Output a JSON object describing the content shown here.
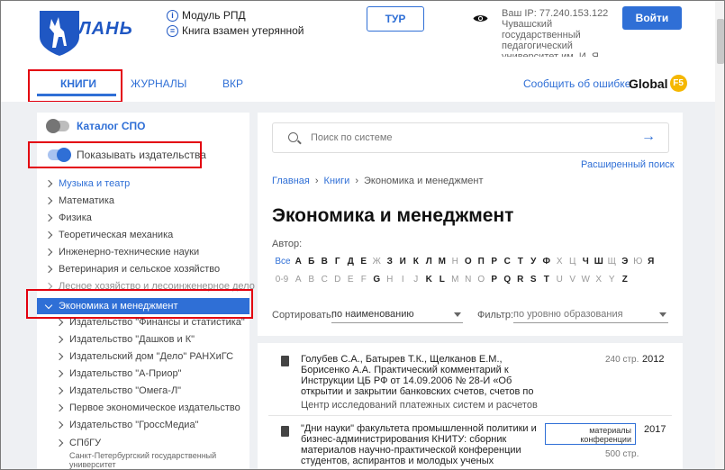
{
  "header": {
    "logo_text": "ЛАНЬ",
    "links": [
      {
        "label": "Модуль РПД",
        "icon": "info-icon"
      },
      {
        "label": "Книга взамен утерянной",
        "icon": "list-icon"
      }
    ],
    "tur_label": "ТУР",
    "ip_info": "Ваш IP: 77.240.153.122 Чувашский государственный педагогический университет им. И. Я. Я",
    "login_label": "Войти"
  },
  "tabs": [
    {
      "label": "КНИГИ",
      "active": true
    },
    {
      "label": "ЖУРНАЛЫ",
      "active": false
    },
    {
      "label": "ВКР",
      "active": false
    }
  ],
  "report_error": "Сообщить об ошибке",
  "global_brand": "Global",
  "global_badge": "F5",
  "sidebar": {
    "catalog_toggle": "Каталог СПО",
    "publishers_toggle": "Показывать издательства",
    "categories": [
      "Музыка и театр",
      "Математика",
      "Физика",
      "Теоретическая механика",
      "Инженерно-технические науки",
      "Ветеринария и сельское хозяйство",
      "Лесное хозяйство и лесоинженерное дело"
    ],
    "active_category": "Экономика и менеджмент",
    "subitems": [
      "Издательство \"Финансы и статистика\"",
      "Издательство \"Дашков и К\"",
      "Издательский дом \"Дело\" РАНХиГС",
      "Издательство \"А-Приор\"",
      "Издательство \"Омега-Л\"",
      "Первое экономическое издательство",
      "Издательство \"ГроссМедиа\"",
      "СПбГУ"
    ],
    "last_note": "Санкт-Петербургский государственный университет"
  },
  "main": {
    "search_placeholder": "Поиск по системе",
    "advanced_search": "Расширенный поиск",
    "breadcrumbs": [
      "Главная",
      "Книги",
      "Экономика и менеджмент"
    ],
    "title": "Экономика и менеджмент",
    "author_label": "Автор:",
    "ru_letters": [
      "Все",
      "А",
      "Б",
      "В",
      "Г",
      "Д",
      "Е",
      "Ж",
      "З",
      "И",
      "К",
      "Л",
      "М",
      "Н",
      "О",
      "П",
      "Р",
      "С",
      "Т",
      "У",
      "Ф",
      "Х",
      "Ц",
      "Ч",
      "Ш",
      "Щ",
      "Э",
      "Ю",
      "Я"
    ],
    "ru_disabled": [
      "Ж",
      "Н",
      "Х",
      "Ц",
      "Щ",
      "Ю"
    ],
    "en_letters": [
      "0-9",
      "A",
      "B",
      "C",
      "D",
      "E",
      "F",
      "G",
      "H",
      "I",
      "J",
      "K",
      "L",
      "M",
      "N",
      "O",
      "P",
      "Q",
      "R",
      "S",
      "T",
      "U",
      "V",
      "W",
      "X",
      "Y",
      "Z"
    ],
    "en_bold": [
      "G",
      "K",
      "L",
      "P",
      "Q",
      "R",
      "S",
      "T",
      "Z"
    ],
    "sort_label": "Сортировать:",
    "sort_value": "по наименованию",
    "filter_label": "Фильтр:",
    "filter_value": "по уровню образования",
    "books": [
      {
        "text": "Голубев С.А., Батырев Т.К., Щелканов Е.М., Борисенко А.А. Практический комментарий к Инструкции ЦБ РФ от 14.09.2006 № 28-И «Об открытии и закрытии банковских счетов, счетов по вкладам (депозитам)»",
        "source": "Центр исследований платежных систем и расчетов",
        "pages": "240 стр.",
        "year": "2012"
      },
      {
        "text": "\"Дни науки\" факультета промышленной политики и бизнес-администрирования КНИТУ: сборник материалов научно-практической конференции студентов, аспирантов и молодых ученых",
        "badge": "материалы конференции",
        "pages": "500 стр.",
        "year": "2017"
      }
    ]
  }
}
